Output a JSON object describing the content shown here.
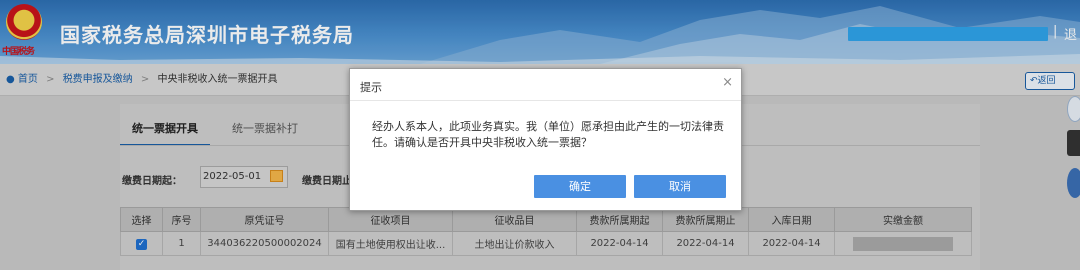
{
  "header": {
    "title": "国家税务总局深圳市电子税务局",
    "brand_text": "中国税务",
    "separator": "|",
    "logout_label": "退"
  },
  "breadcrumb": {
    "home": "首页",
    "arrow": ">",
    "level1": "税费申报及缴纳",
    "level2": "中央非税收入统一票据开具"
  },
  "back_button": "返回",
  "tabs": [
    {
      "label": "统一票据开具",
      "active": true
    },
    {
      "label": "统一票据补打",
      "active": false
    }
  ],
  "filters": {
    "start_label": "缴费日期起：",
    "start_value": "2022-05-01",
    "end_label": "缴费日期止"
  },
  "table": {
    "headers": [
      "选择",
      "序号",
      "原凭证号",
      "征收项目",
      "征收品目",
      "费款所属期起",
      "费款所属期止",
      "入库日期",
      "实缴金额"
    ],
    "rows": [
      {
        "checked": true,
        "index": "1",
        "voucher": "344036220500002024",
        "item": "国有土地使用权出让收...",
        "subitem": "土地出让价款收入",
        "period_start": "2022-04-14",
        "period_end": "2022-04-14",
        "storage_date": "2022-04-14"
      }
    ]
  },
  "dialog": {
    "title": "提示",
    "close": "×",
    "message": "经办人系本人，此项业务真实。我（单位）愿承担由此产生的一切法律责任。请确认是否开具中央非税收入统一票据？",
    "confirm_label": "确定",
    "cancel_label": "取消"
  },
  "colors": {
    "accent": "#4a90e2",
    "header_blue": "#2d6fb3",
    "link_blue": "#1a5fa8"
  }
}
